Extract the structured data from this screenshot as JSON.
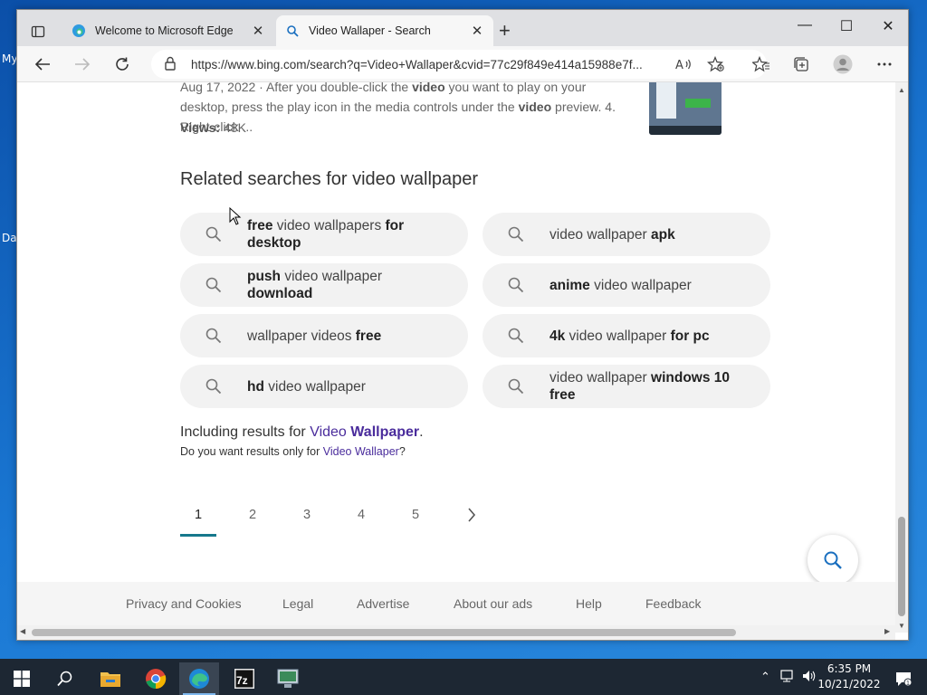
{
  "browser": {
    "tabs": [
      {
        "title": "Welcome to Microsoft Edge",
        "icon": "edge-icon"
      },
      {
        "title": "Video Wallaper - Search",
        "icon": "search-icon"
      }
    ],
    "address_url": "https://www.bing.com/search?q=Video+Wallaper&cvid=77c29f849e414a15988e7f..."
  },
  "desktop": {
    "icon_label_1": "My",
    "icon_label_2": "Da"
  },
  "result": {
    "snippet_date": "Aug 17, 2022 · After you double-click the",
    "snippet_b1": "video",
    "snippet_mid": "you want to play on your desktop, press the play icon in the media controls under the",
    "snippet_b2": "video",
    "snippet_end": "preview. 4. Right-click ...",
    "views_label": "Views:",
    "views_value": "48K"
  },
  "related": {
    "title": "Related searches for video wallpaper",
    "items": [
      {
        "parts": [
          [
            "b",
            "free"
          ],
          [
            "n",
            " video wallpapers "
          ],
          [
            "b",
            "for desktop"
          ]
        ]
      },
      {
        "parts": [
          [
            "n",
            "video wallpaper "
          ],
          [
            "b",
            "apk"
          ]
        ]
      },
      {
        "parts": [
          [
            "b",
            "push"
          ],
          [
            "n",
            " video wallpaper "
          ],
          [
            "b",
            "download"
          ]
        ]
      },
      {
        "parts": [
          [
            "b",
            "anime"
          ],
          [
            "n",
            " video wallpaper"
          ]
        ]
      },
      {
        "parts": [
          [
            "n",
            "wallpaper videos "
          ],
          [
            "b",
            "free"
          ]
        ]
      },
      {
        "parts": [
          [
            "b",
            "4k"
          ],
          [
            "n",
            " video wallpaper "
          ],
          [
            "b",
            "for pc"
          ]
        ]
      },
      {
        "parts": [
          [
            "b",
            "hd"
          ],
          [
            "n",
            " video wallpaper"
          ]
        ]
      },
      {
        "parts": [
          [
            "n",
            "video wallpaper "
          ],
          [
            "b",
            "windows 10 free"
          ]
        ]
      }
    ]
  },
  "including": {
    "prefix": "Including results for",
    "link_normal": "Video",
    "link_bold": "Wallpaper",
    "suffix": ".",
    "question_prefix": "Do you want results only for",
    "question_link": "Video Wallaper",
    "question_suffix": "?"
  },
  "pagination": {
    "pages": [
      "1",
      "2",
      "3",
      "4",
      "5"
    ],
    "active": "1"
  },
  "footer": {
    "links": [
      "Privacy and Cookies",
      "Legal",
      "Advertise",
      "About our ads",
      "Help",
      "Feedback"
    ]
  },
  "clock": {
    "time": "6:35 PM",
    "date": "10/21/2022"
  },
  "colors": {
    "accent": "#16788c",
    "link": "#4a2c9c",
    "taskbar": "#1d2733"
  }
}
